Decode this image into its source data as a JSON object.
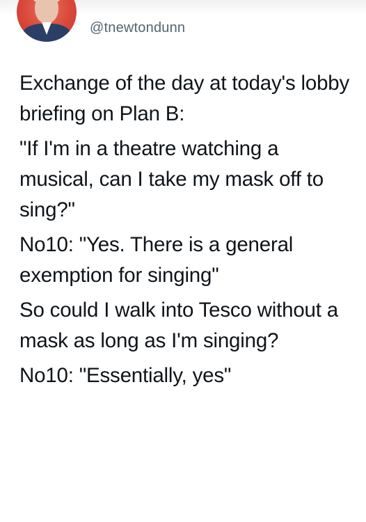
{
  "tweet": {
    "handle": "@tnewtondunn",
    "paragraphs": [
      "Exchange of the day at today's lobby briefing on Plan B:",
      "\"If I'm in a theatre watching a musical, can I take my mask off to sing?\"",
      "No10: \"Yes. There is a general exemption for singing\"",
      "So could I walk into Tesco without a mask as long as I'm singing?",
      "No10: \"Essentially, yes\""
    ]
  },
  "colors": {
    "text": "#0f1419",
    "handle": "#536471",
    "avatar_bg": "#d9473a"
  }
}
